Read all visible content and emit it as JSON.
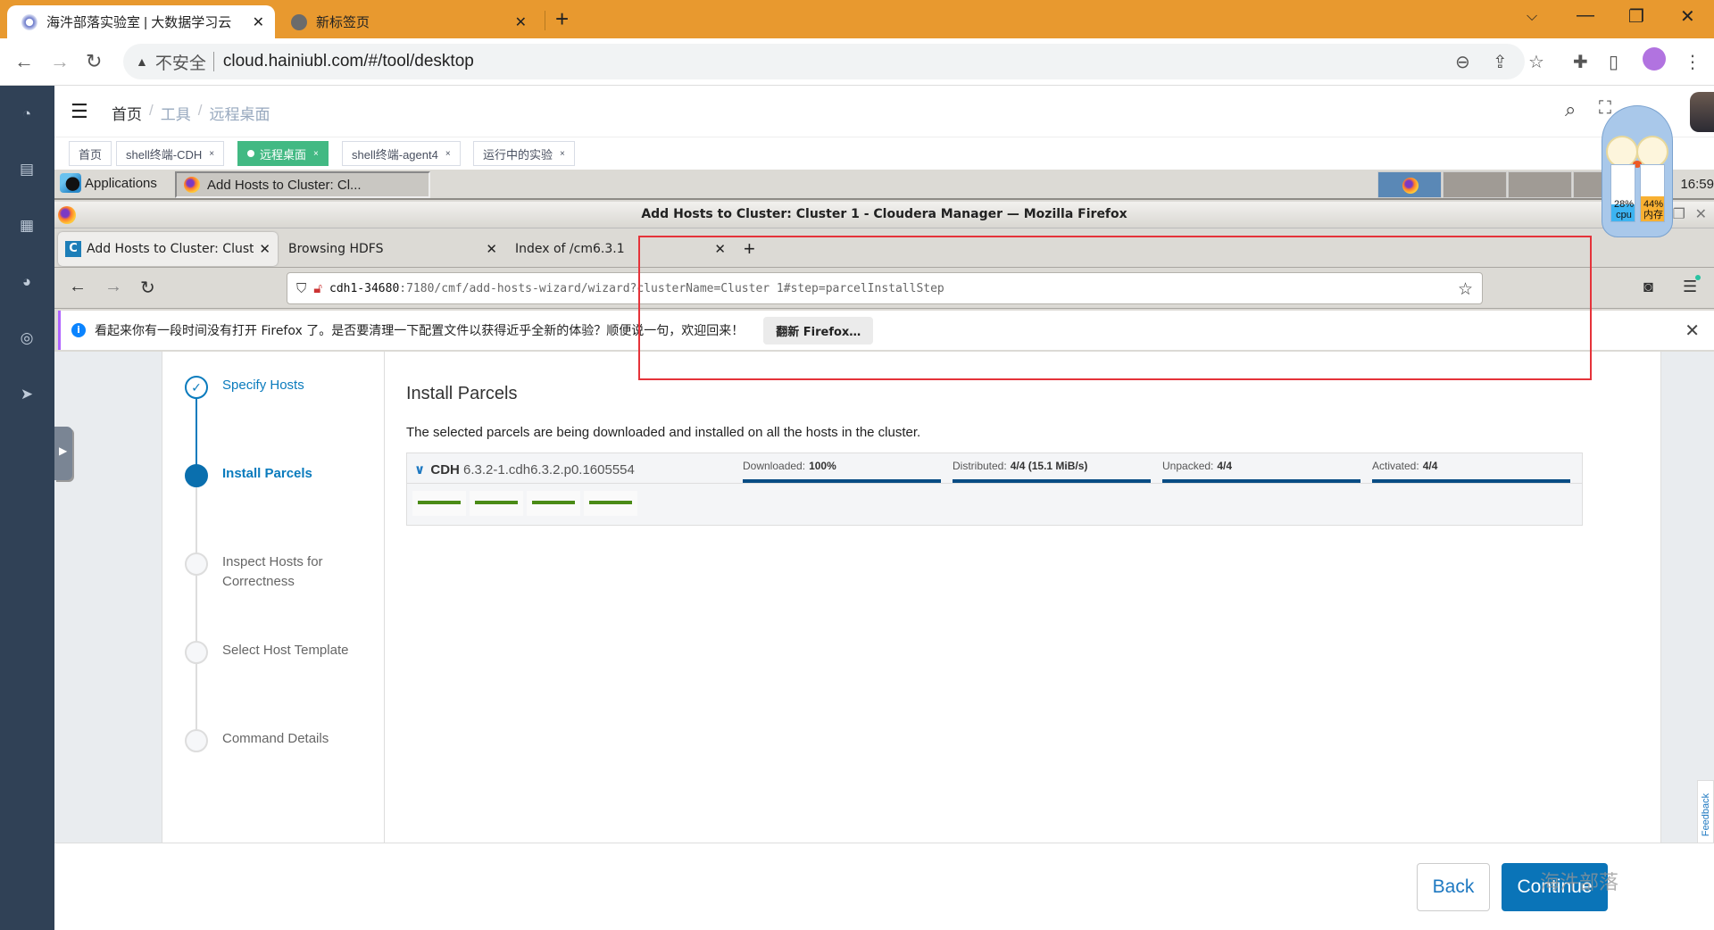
{
  "browser": {
    "tabs": [
      {
        "title": "海汼部落实验室 | 大数据学习云",
        "active": true
      },
      {
        "title": "新标签页",
        "active": false
      }
    ],
    "new_tab_label": "+",
    "security_label": "不安全",
    "url": "cloud.hainiubl.com/#/tool/desktop",
    "icons": [
      "back-icon",
      "forward-icon",
      "reload-icon",
      "zoom-out-icon",
      "share-icon",
      "bookmark-star-icon",
      "extensions-icon",
      "side-panel-icon",
      "profile-avatar-icon",
      "menu-kebab-icon"
    ]
  },
  "app": {
    "sidebar_icons": [
      "dashboard-icon",
      "document-icon",
      "apps-grid-icon",
      "globe-icon",
      "lifebuoy-icon",
      "send-icon"
    ],
    "breadcrumb": [
      "首页",
      "工具",
      "远程桌面"
    ],
    "breadcrumb_sep": "/",
    "tags": [
      {
        "label": "首页",
        "closable": false,
        "active": false
      },
      {
        "label": "shell终端-CDH",
        "closable": true,
        "active": false
      },
      {
        "label": "远程桌面",
        "closable": true,
        "active": true
      },
      {
        "label": "shell终端-agent4",
        "closable": true,
        "active": false
      },
      {
        "label": "运行中的实验",
        "closable": true,
        "active": false
      }
    ],
    "tag_close": "×"
  },
  "desktop": {
    "panel": {
      "applications_label": "Applications",
      "task_label": "Add Hosts to Cluster: Cl...",
      "clock": "16:59"
    },
    "monitor": {
      "cpu_percent": 28,
      "cpu_label": "cpu",
      "mem_percent": 44,
      "mem_label": "内存"
    }
  },
  "firefox": {
    "window_title": "Add Hosts to Cluster: Cluster 1 - Cloudera Manager — Mozilla Firefox",
    "tabs": [
      {
        "title": "Add Hosts to Cluster: Clust",
        "active": true,
        "favicon": "C"
      },
      {
        "title": "Browsing HDFS",
        "active": false
      },
      {
        "title": "Index of /cm6.3.1",
        "active": false
      }
    ],
    "url_host": "cdh1-34680",
    "url_rest": ":7180/cmf/add-hosts-wizard/wizard?clusterName=Cluster 1#step=parcelInstallStep",
    "notice": {
      "text": "看起来你有一段时间没有打开 Firefox 了。是否要清理一下配置文件以获得近乎全新的体验？顺便说一句，欢迎回来！",
      "button": "翻新 Firefox…"
    }
  },
  "wizard": {
    "steps": [
      {
        "label": "Specify Hosts",
        "state": "done"
      },
      {
        "label": "Install Parcels",
        "state": "current"
      },
      {
        "label": "Inspect Hosts for Correctness",
        "state": "pending"
      },
      {
        "label": "Select Host Template",
        "state": "pending"
      },
      {
        "label": "Command Details",
        "state": "pending"
      }
    ],
    "title": "Install Parcels",
    "description": "The selected parcels are being downloaded and installed on all the hosts in the cluster.",
    "parcel": {
      "name": "CDH",
      "version": "6.3.2-1.cdh6.3.2.p0.1605554",
      "stages": [
        {
          "label": "Downloaded:",
          "value": "100%",
          "progress": 1.0
        },
        {
          "label": "Distributed:",
          "value": "4/4 (15.1 MiB/s)",
          "progress": 1.0
        },
        {
          "label": "Unpacked:",
          "value": "4/4",
          "progress": 1.0
        },
        {
          "label": "Activated:",
          "value": "4/4",
          "progress": 1.0
        }
      ],
      "host_count": 4
    },
    "feedback_label": "Feedback",
    "back_label": "Back",
    "continue_label": "Continue",
    "watermark": "海汼部落"
  },
  "colors": {
    "chrome_frame": "#e8992f",
    "sidebar_bg": "#304156",
    "tag_active": "#42b983",
    "cm_blue": "#0a74b8",
    "progress_fill": "#084c84",
    "host_ok": "#4a8b16",
    "annotation_red": "#e5333a"
  }
}
